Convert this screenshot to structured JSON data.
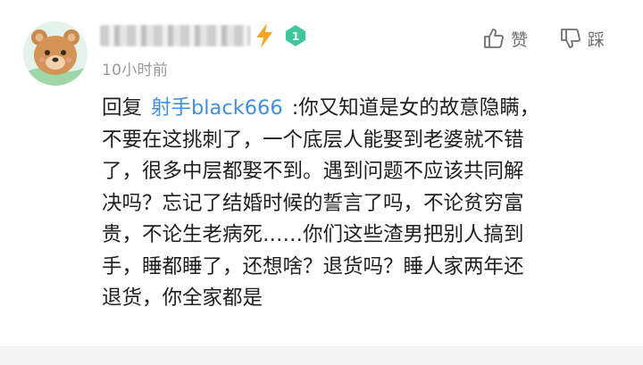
{
  "comment": {
    "time": "10小时前",
    "actions": {
      "like_label": "赞",
      "dislike_label": "踩"
    },
    "reply": {
      "prefix": "回复",
      "mention": "射手black666",
      "lines": [
        ":你又知道是女的故意隐瞒，",
        "不要在这挑刺了，一个底层人能娶到老婆就不错",
        "了，很多中层都娶不到。遇到问题不应该共同解",
        "决吗？忘记了结婚时候的誓言了吗，不论贫穷富",
        "贵，不论生老病死……你们这些渣男把别人搞到",
        "手，睡都睡了，还想啥？退货吗？睡人家两年还",
        "退货，你全家都是"
      ]
    },
    "level_badge": "1",
    "icons": {
      "avatar": "cartoon-bear-avatar",
      "vip": "lightning-bolt-icon",
      "level": "green-diamond-level-icon",
      "like": "thumbs-up-icon",
      "dislike": "thumbs-down-icon"
    },
    "colors": {
      "mention": "#3d8fe8",
      "bolt": "#f5a623",
      "level_badge": "#3cc99a",
      "time": "#9a9a9a"
    }
  }
}
